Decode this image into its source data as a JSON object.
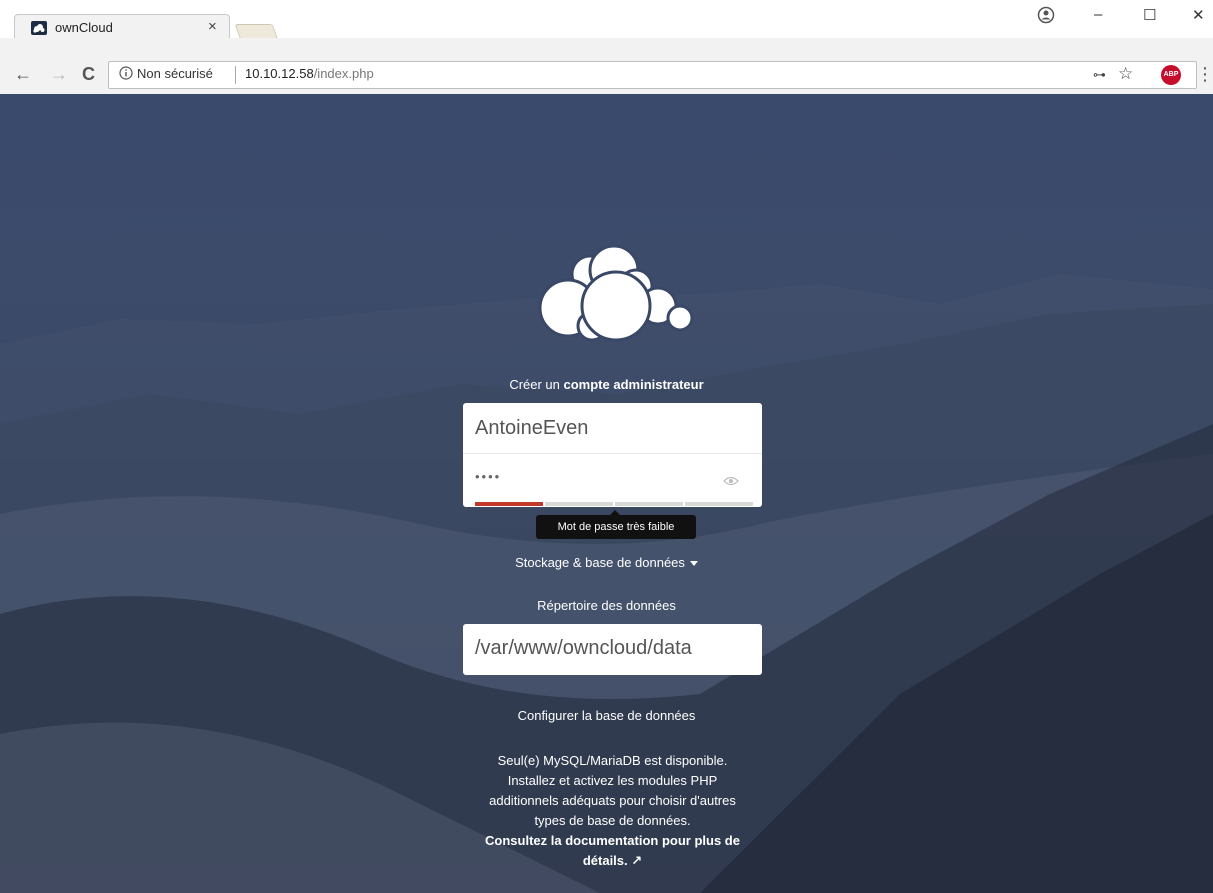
{
  "browser": {
    "tab_title": "ownCloud",
    "tab_close": "×",
    "security_label": "Non sécurisé",
    "url_host": "10.10.12.58",
    "url_path": "/index.php",
    "window_controls": {
      "minimize": "–",
      "maximize": "☐",
      "close": "✕"
    }
  },
  "setup": {
    "heading_prefix": "Créer un",
    "heading_bold": "compte administrateur",
    "username_value": "AntoineEven",
    "password_value": "••••",
    "password_strength": 0.25,
    "password_strength_tooltip": "Mot de passe très faible",
    "storage_toggle_label": "Stockage & base de données",
    "data_dir_label": "Répertoire des données",
    "data_dir_value": "/var/www/owncloud/data",
    "db_config_label": "Configurer la base de données",
    "db_info_lines": [
      "Seul(e) MySQL/MariaDB est disponible.",
      "Installez et activez les modules PHP",
      "additionnels adéquats pour choisir d'autres",
      "types de base de données."
    ],
    "doc_link_text": "Consultez la documentation pour plus de détails. ↗"
  },
  "colors": {
    "strength_weak": "#c0392b",
    "strength_empty": "#d9d9d9",
    "abp": "#c70d2c"
  },
  "icons": {
    "tab_favicon": "owncloud-favicon-icon",
    "back": "back-arrow-icon",
    "forward": "forward-arrow-icon",
    "reload": "reload-icon",
    "info": "info-icon",
    "key": "key-icon",
    "star": "star-icon",
    "abp": "adblock-plus-icon",
    "menu": "kebab-menu-icon",
    "profile": "profile-icon",
    "eye": "eye-icon",
    "logo": "owncloud-logo-icon"
  }
}
